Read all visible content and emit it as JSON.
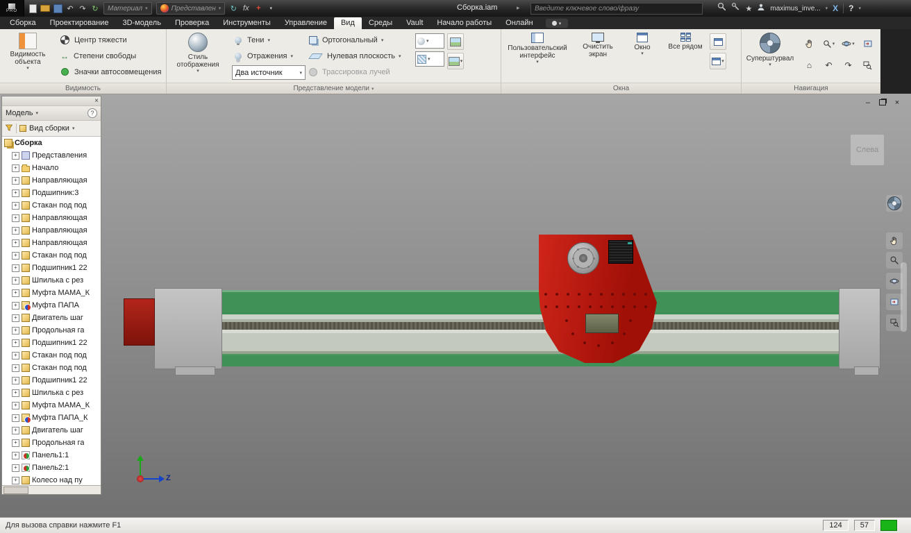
{
  "titlebar": {
    "brand": "PRO",
    "material_combo": "Материал",
    "appearance_combo": "Представлен",
    "doc_title": "Сборка.iam",
    "search_placeholder": "Введите ключевое слово/фразу",
    "username": "maximus_inve..."
  },
  "tabs": {
    "active": "Вид",
    "items": [
      "Сборка",
      "Проектирование",
      "3D-модель",
      "Проверка",
      "Инструменты",
      "Управление",
      "Вид",
      "Среды",
      "Vault",
      "Начало работы",
      "Онлайн"
    ]
  },
  "ribbon": {
    "groups": {
      "visibility": {
        "label": "Видимость",
        "object_visibility": "Видимость объекта",
        "center_of_gravity": "Центр тяжести",
        "degrees_of_freedom": "Степени свободы",
        "imate_glyphs": "Значки автосовмещения"
      },
      "model_appearance": {
        "label": "Представление модели",
        "display_style": "Стиль отображения",
        "shadows": "Тени",
        "reflections": "Отражения",
        "lights": "Два источник",
        "orthographic": "Ортогональный",
        "ground_plane": "Нулевая плоскость",
        "ray_tracing": "Трассировка лучей"
      },
      "windows": {
        "label": "Окна",
        "user_interface": "Пользовательский интерфейс",
        "clean_screen": "Очистить экран",
        "window": "Окно",
        "tile_all": "Все рядом"
      },
      "navigation": {
        "label": "Навигация",
        "steering_wheel": "Суперштурвал"
      }
    }
  },
  "browser": {
    "panel_title": "Модель",
    "view_mode": "Вид сборки",
    "tree": [
      {
        "label": "Сборка",
        "icon": "assembly",
        "root": true
      },
      {
        "label": "Представления",
        "icon": "views-folder"
      },
      {
        "label": "Начало",
        "icon": "folder"
      },
      {
        "label": "Направляющая",
        "icon": "part"
      },
      {
        "label": "Подшипник:3",
        "icon": "part"
      },
      {
        "label": "Стакан под под",
        "icon": "part"
      },
      {
        "label": "Направляющая",
        "icon": "part"
      },
      {
        "label": "Направляющая",
        "icon": "part"
      },
      {
        "label": "Направляющая",
        "icon": "part"
      },
      {
        "label": "Стакан под под",
        "icon": "part"
      },
      {
        "label": "Подшипник1 22",
        "icon": "part"
      },
      {
        "label": "Шпилька с рез",
        "icon": "part"
      },
      {
        "label": "Муфта МАМА_К",
        "icon": "part"
      },
      {
        "label": "Муфта ПАПА",
        "icon": "adaptive"
      },
      {
        "label": "Двигатель шаг",
        "icon": "part"
      },
      {
        "label": "Продольная га",
        "icon": "part"
      },
      {
        "label": "Подшипник1 22",
        "icon": "part"
      },
      {
        "label": "Стакан под под",
        "icon": "part"
      },
      {
        "label": "Стакан под под",
        "icon": "part"
      },
      {
        "label": "Подшипник1 22",
        "icon": "part"
      },
      {
        "label": "Шпилька с рез",
        "icon": "part"
      },
      {
        "label": "Муфта МАМА_К",
        "icon": "part"
      },
      {
        "label": "Муфта ПАПА_К",
        "icon": "adaptive"
      },
      {
        "label": "Двигатель шаг",
        "icon": "part"
      },
      {
        "label": "Продольная га",
        "icon": "part"
      },
      {
        "label": "Панель1:1",
        "icon": "flexible"
      },
      {
        "label": "Панель2:1",
        "icon": "flexible"
      },
      {
        "label": "Колесо над пу",
        "icon": "part"
      }
    ]
  },
  "viewport": {
    "viewcube_label": "Слева",
    "axis_z": "Z",
    "model_colors": {
      "rail_green": "#3f9158",
      "part_red": "#c01810",
      "block_gray": "#b4b4b4"
    }
  },
  "statusbar": {
    "help_text": "Для вызова справки нажмите F1",
    "count1": "124",
    "count2": "57"
  }
}
